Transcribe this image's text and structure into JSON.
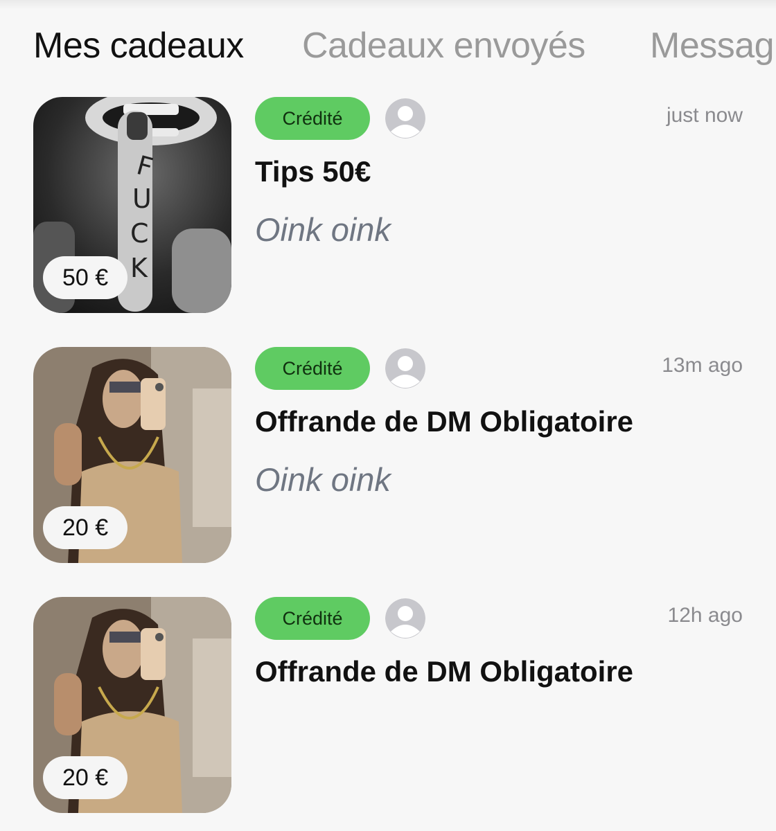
{
  "tabs": [
    {
      "label": "Mes cadeaux",
      "active": true
    },
    {
      "label": "Cadeaux envoyés",
      "active": false
    },
    {
      "label": "Messag",
      "active": false
    }
  ],
  "colors": {
    "badge_green": "#5fcb62",
    "active_tab": "#111111",
    "inactive_tab": "#9a9a9a",
    "background": "#f7f7f7"
  },
  "gifts": [
    {
      "price": "50 €",
      "status": "Crédité",
      "avatar_icon": "user-placeholder-icon",
      "time": "just now",
      "title": "Tips 50€",
      "message": "Oink oink"
    },
    {
      "price": "20 €",
      "status": "Crédité",
      "avatar_icon": "user-placeholder-icon",
      "time": "13m ago",
      "title": "Offrande de DM Obligatoire",
      "message": "Oink oink"
    },
    {
      "price": "20 €",
      "status": "Crédité",
      "avatar_icon": "user-placeholder-icon",
      "time": "12h ago",
      "title": "Offrande de DM Obligatoire",
      "message": ""
    }
  ]
}
